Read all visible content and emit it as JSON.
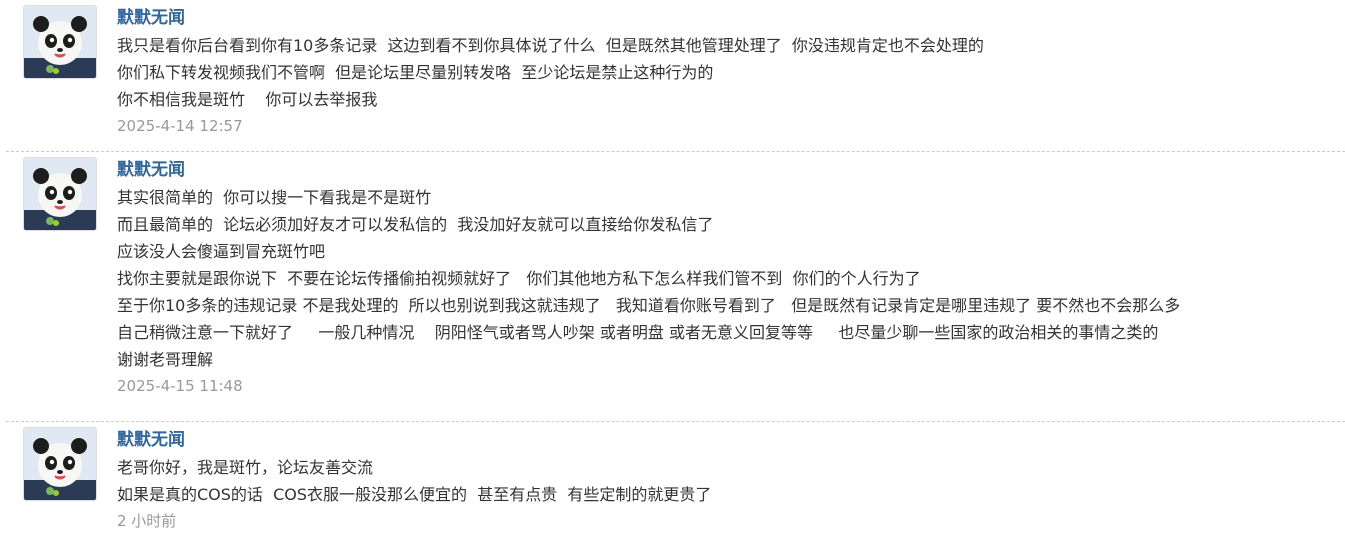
{
  "messages": [
    {
      "author": "默默无闻",
      "lines": [
        "我只是看你后台看到你有10多条记录  这边到看不到你具体说了什么  但是既然其他管理处理了  你没违规肯定也不会处理的",
        "你们私下转发视频我们不管啊  但是论坛里尽量别转发咯  至少论坛是禁止这种行为的",
        "你不相信我是斑竹    你可以去举报我"
      ],
      "time": "2025-4-14 12:57"
    },
    {
      "author": "默默无闻",
      "lines": [
        "其实很简单的  你可以搜一下看我是不是斑竹",
        "而且最简单的  论坛必须加好友才可以发私信的  我没加好友就可以直接给你发私信了",
        "应该没人会傻逼到冒充斑竹吧",
        "找你主要就是跟你说下  不要在论坛传播偷拍视频就好了   你们其他地方私下怎么样我们管不到  你们的个人行为了",
        "至于你10多条的违规记录 不是我处理的  所以也别说到我这就违规了   我知道看你账号看到了   但是既然有记录肯定是哪里违规了 要不然也不会那么多",
        "自己稍微注意一下就好了     一般几种情况    阴阳怪气或者骂人吵架 或者明盘 或者无意义回复等等     也尽量少聊一些国家的政治相关的事情之类的",
        "谢谢老哥理解"
      ],
      "time": "2025-4-15 11:48"
    },
    {
      "author": "默默无闻",
      "lines": [
        "老哥你好，我是斑竹，论坛友善交流",
        "如果是真的COS的话  COS衣服一般没那么便宜的  甚至有点贵  有些定制的就更贵了"
      ],
      "time": "2 小时前"
    }
  ],
  "avatar_icon": "panda-avatar-icon",
  "colors": {
    "author": "#336699",
    "text": "#333333",
    "time": "#999999",
    "divider": "#cccccc"
  }
}
